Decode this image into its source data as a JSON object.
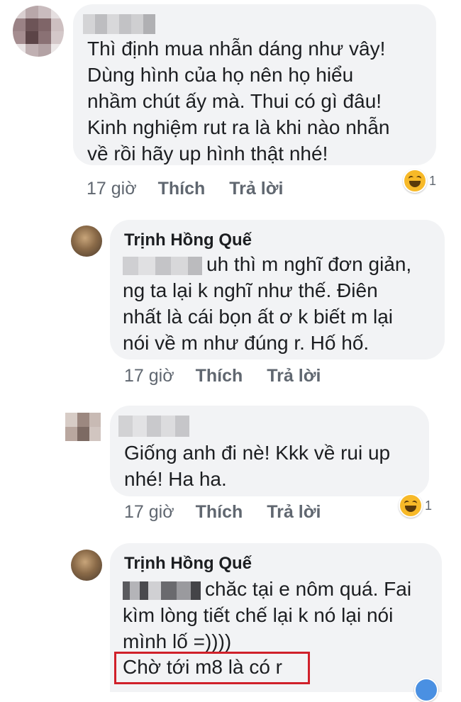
{
  "comments": [
    {
      "author": "",
      "lines": [
        "Thì định mua nhẫn dáng như vây!",
        "Dùng hình của họ nên họ hiểu",
        "nhầm chút ấy mà. Thui có gì đâu!",
        "Kinh nghiệm rut ra là khi nào nhẫn",
        "về rồi hãy up hình thật nhé!"
      ],
      "time": "17 giờ",
      "like": "Thích",
      "reply": "Trả lời",
      "reaction_icon": "laughing-emoji-icon",
      "reaction_count": "1"
    },
    {
      "author": "Trịnh Hồng Quế",
      "lines": [
        "uh thì m nghĩ đơn giản,",
        "ng ta lại k nghĩ như thế. Điên",
        "nhất là cái bọn ất ơ k biết m lại",
        "nói về m như đúng r. Hố hố."
      ],
      "time": "17 giờ",
      "like": "Thích",
      "reply": "Trả lời"
    },
    {
      "author": "",
      "lines": [
        "Giống anh đi nè! Kkk về rui up",
        "nhé! Ha ha."
      ],
      "time": "17 giờ",
      "like": "Thích",
      "reply": "Trả lời",
      "reaction_icon": "laughing-emoji-icon",
      "reaction_count": "1"
    },
    {
      "author": "Trịnh Hồng Quế",
      "lines": [
        "chăc tại e nôm quá. Fai",
        "kìm lòng tiết chế lại k nó lại nói",
        "mình lố =))))",
        "Chờ tới m8 là có r"
      ]
    }
  ],
  "colors": {
    "bubble": "#f2f3f5",
    "text": "#1c1e21",
    "meta": "#606770",
    "highlight_box": "#d0202a"
  }
}
